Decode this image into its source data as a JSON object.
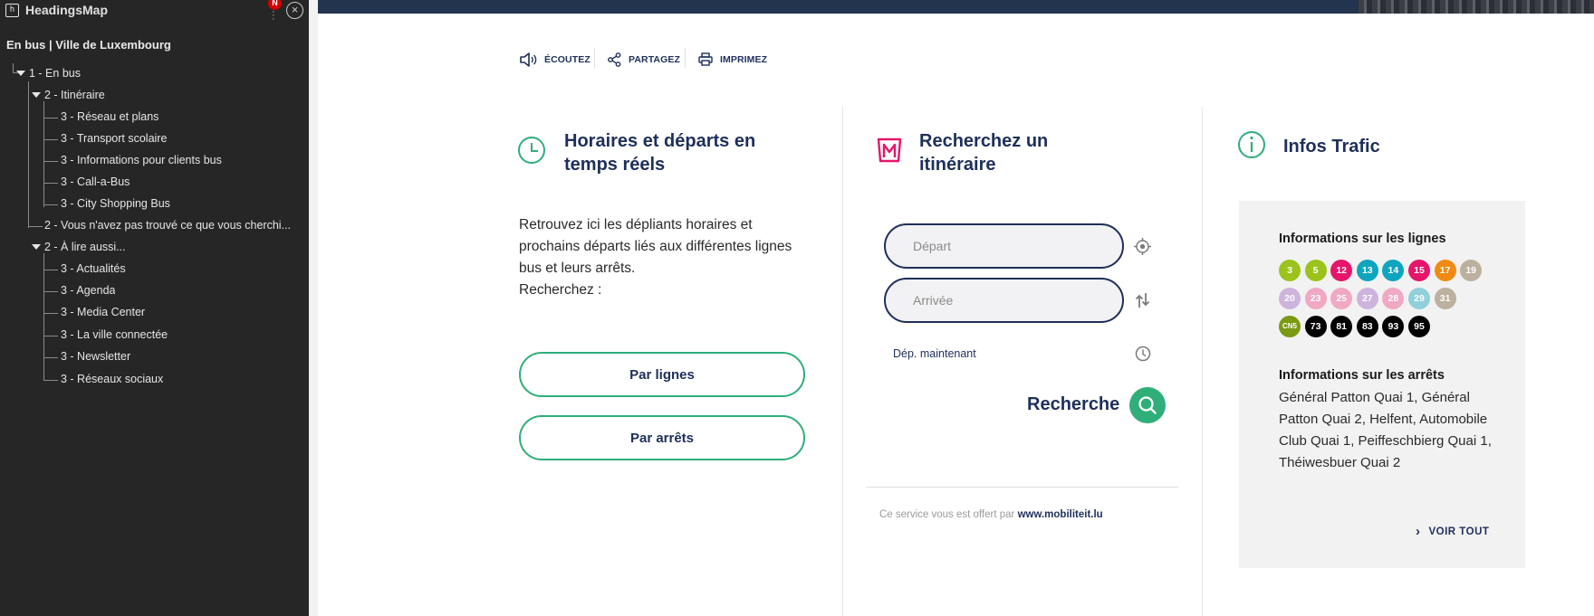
{
  "headingsmap": {
    "app_name": "HeadingsMap",
    "notification_badge": "N",
    "document_title": "En bus | Ville de Luxembourg",
    "items": [
      {
        "label": "1 - En bus"
      },
      {
        "label": "2 - Itinéraire"
      },
      {
        "label": "3 -  Réseau et plans"
      },
      {
        "label": "3 -  Transport scolaire"
      },
      {
        "label": "3 -  Informations pour clients bus"
      },
      {
        "label": "3 -  Call-a-Bus"
      },
      {
        "label": "3 -  City Shopping Bus"
      },
      {
        "label": "2 - Vous n'avez pas trouvé ce que vous cherchi..."
      },
      {
        "label": "2 - À lire aussi..."
      },
      {
        "label": "3 - Actualités"
      },
      {
        "label": "3 - Agenda"
      },
      {
        "label": "3 - Media Center"
      },
      {
        "label": "3 - La ville connectée"
      },
      {
        "label": "3 - Newsletter"
      },
      {
        "label": "3 - Réseaux sociaux"
      }
    ]
  },
  "toolbar": {
    "listen": "ÉCOUTEZ",
    "share": "PARTAGEZ",
    "print": "IMPRIMEZ"
  },
  "timetables": {
    "title_line1": "Horaires et départs en",
    "title_line2": "temps réels",
    "description": "Retrouvez ici les dépliants horaires et prochains départs liés aux différentes lignes bus et leurs arrêts.",
    "search_prompt": "Recherchez :",
    "by_lines": "Par lignes",
    "by_stops": "Par arrêts"
  },
  "route_planner": {
    "title_line1": "Recherchez un",
    "title_line2": "itinéraire",
    "departure_placeholder": "Départ",
    "arrival_placeholder": "Arrivée",
    "departure_time": "Dép. maintenant",
    "search_label": "Recherche",
    "service_text": "Ce service vous est offert par",
    "service_link": "www.mobiliteit.lu"
  },
  "traffic": {
    "title": "Infos Trafic",
    "lines_title": "Informations sur les lignes",
    "lines": [
      {
        "label": "3",
        "color": "#9bc31c"
      },
      {
        "label": "5",
        "color": "#9bc31c"
      },
      {
        "label": "12",
        "color": "#e6156a"
      },
      {
        "label": "13",
        "color": "#0ea5be"
      },
      {
        "label": "14",
        "color": "#0ea5be"
      },
      {
        "label": "15",
        "color": "#e6156a"
      },
      {
        "label": "17",
        "color": "#f08a12"
      },
      {
        "label": "19",
        "color": "#bcb09e"
      },
      {
        "label": "20",
        "color": "#cdb4dc"
      },
      {
        "label": "23",
        "color": "#f0a8c3"
      },
      {
        "label": "25",
        "color": "#f0a8c3"
      },
      {
        "label": "27",
        "color": "#cdb4dc"
      },
      {
        "label": "28",
        "color": "#f0a8c3"
      },
      {
        "label": "29",
        "color": "#8fd0da"
      },
      {
        "label": "31",
        "color": "#bcb09e"
      },
      {
        "label": "CN5",
        "color": "#7a9a12"
      },
      {
        "label": "73",
        "color": "#000000"
      },
      {
        "label": "81",
        "color": "#000000"
      },
      {
        "label": "83",
        "color": "#000000"
      },
      {
        "label": "93",
        "color": "#000000"
      },
      {
        "label": "95",
        "color": "#000000"
      }
    ],
    "stops_title": "Informations sur les arrêts",
    "stops_text": "Général Patton Quai 1, Général Patton Quai 2, Helfent, Automobile Club Quai 1, Peiffeschbierg Quai 1, Théiwesbuer Quai 2",
    "see_all": "VOIR TOUT"
  },
  "colors": {
    "navy": "#1e2f5a",
    "green": "#2fae7a",
    "magenta": "#e6156a"
  }
}
